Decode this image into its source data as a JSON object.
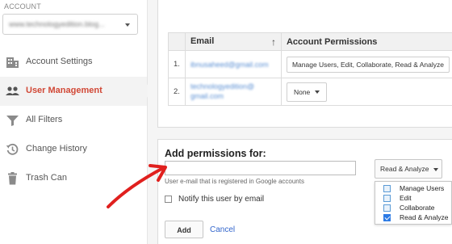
{
  "sidebar": {
    "account_label": "ACCOUNT",
    "account_value": "www.technologyedition.blog...",
    "items": [
      {
        "label": "Account Settings",
        "icon": "building-icon",
        "active": false
      },
      {
        "label": "User Management",
        "icon": "users-icon",
        "active": true
      },
      {
        "label": "All Filters",
        "icon": "filter-icon",
        "active": false
      },
      {
        "label": "Change History",
        "icon": "history-icon",
        "active": false
      },
      {
        "label": "Trash Can",
        "icon": "trash-icon",
        "active": false
      }
    ]
  },
  "table": {
    "headers": {
      "num": "",
      "email": "Email",
      "permissions": "Account Permissions"
    },
    "rows": [
      {
        "num": "1.",
        "email": "ibnusaheed@gmail.com",
        "permissions": "Manage Users, Edit, Collaborate, Read & Analyze"
      },
      {
        "num": "2.",
        "email": "technologyedition@gmail.com",
        "permissions": "None"
      }
    ]
  },
  "add_permissions": {
    "title": "Add permissions for:",
    "email_value": "",
    "email_help": "User e-mail that is registered in Google accounts",
    "notify_label": "Notify this user by email",
    "add_button": "Add",
    "cancel_link": "Cancel",
    "role_dropdown": "Read & Analyze",
    "role_options": [
      {
        "label": "Manage Users",
        "checked": false
      },
      {
        "label": "Edit",
        "checked": false
      },
      {
        "label": "Collaborate",
        "checked": false
      },
      {
        "label": "Read & Analyze",
        "checked": true
      }
    ]
  },
  "colors": {
    "active_nav": "#d14836",
    "link": "#3366cc",
    "annotation_arrow": "#e0201e",
    "checkbox_checked": "#2c7be5"
  }
}
